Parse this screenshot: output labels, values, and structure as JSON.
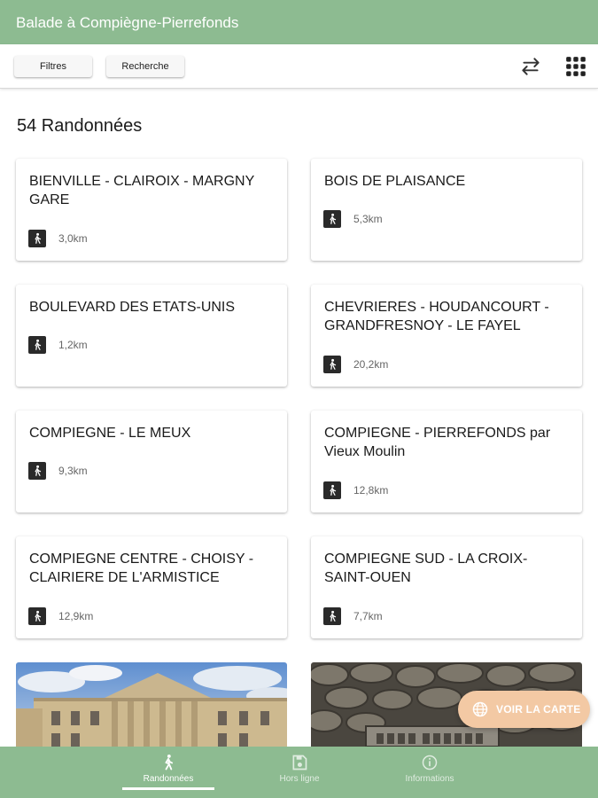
{
  "app": {
    "title": "Balade à Compiègne-Pierrefonds"
  },
  "toolbar": {
    "filters_label": "Filtres",
    "search_label": "Recherche",
    "swap_icon": "swap-arrows-icon",
    "grid_icon": "grid-view-icon"
  },
  "results": {
    "count_label": "54 Randonnées",
    "cards": [
      {
        "name": "BIENVILLE - CLAIROIX - MARGNY GARE",
        "distance": "3,0km"
      },
      {
        "name": "BOIS DE PLAISANCE",
        "distance": "5,3km"
      },
      {
        "name": "BOULEVARD DES ETATS-UNIS",
        "distance": "1,2km"
      },
      {
        "name": "CHEVRIERES - HOUDANCOURT - GRANDFRESNOY - LE FAYEL",
        "distance": "20,2km"
      },
      {
        "name": "COMPIEGNE - LE MEUX",
        "distance": "9,3km"
      },
      {
        "name": "COMPIEGNE - PIERREFONDS par Vieux Moulin",
        "distance": "12,8km"
      },
      {
        "name": "COMPIEGNE CENTRE - CHOISY - CLAIRIERE DE L'ARMISTICE",
        "distance": "12,9km"
      },
      {
        "name": "COMPIEGNE SUD - LA CROIX-SAINT-OUEN",
        "distance": "7,7km"
      }
    ]
  },
  "fab": {
    "label": "VOIR LA CARTE",
    "icon": "globe-icon"
  },
  "bottom_nav": {
    "items": [
      {
        "label": "Randonnées",
        "icon": "hiker-icon",
        "active": true
      },
      {
        "label": "Hors ligne",
        "icon": "save-icon",
        "active": false
      },
      {
        "label": "Informations",
        "icon": "info-icon",
        "active": false
      }
    ]
  },
  "colors": {
    "primary": "#8dbb91",
    "fab": "#f3c9a4",
    "card_bg": "#ffffff"
  }
}
